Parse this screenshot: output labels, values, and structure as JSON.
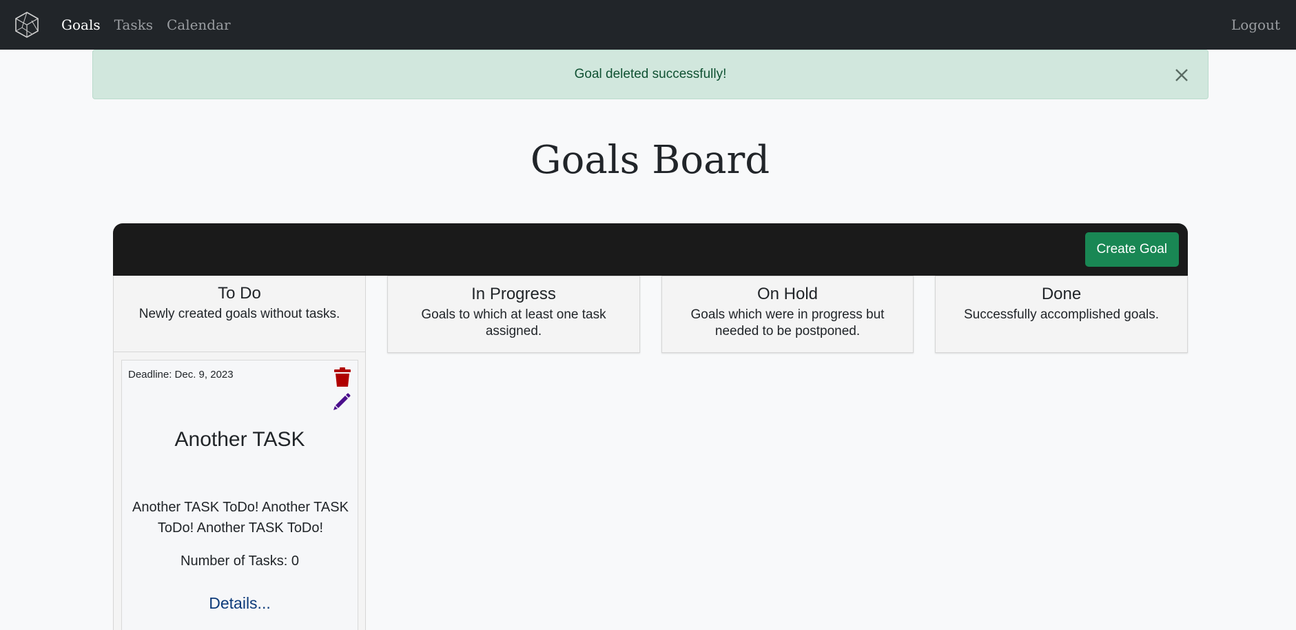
{
  "nav": {
    "brand_icon": "cube-logo-icon",
    "links": [
      {
        "label": "Goals",
        "active": true
      },
      {
        "label": "Tasks",
        "active": false
      },
      {
        "label": "Calendar",
        "active": false
      }
    ],
    "logout_label": "Logout"
  },
  "alert": {
    "message": "Goal deleted successfully!",
    "close_icon": "close-icon",
    "color": "#d1e7dd"
  },
  "page": {
    "title": "Goals Board"
  },
  "board": {
    "create_label": "Create Goal",
    "create_color": "#198754",
    "columns": [
      {
        "title": "To Do",
        "description": "Newly created goals without tasks."
      },
      {
        "title": "In Progress",
        "description": "Goals to which at least one task assigned."
      },
      {
        "title": "On Hold",
        "description": "Goals which were in progress but needed to be postponed."
      },
      {
        "title": "Done",
        "description": "Successfully accomplished goals."
      }
    ]
  },
  "goal_card": {
    "deadline": "Deadline: Dec. 9, 2023",
    "title": "Another TASK",
    "description": "Another TASK ToDo! Another TASK ToDo! Another TASK ToDo!",
    "tasks_count": "Number of Tasks: 0",
    "details_label": "Details...",
    "delete_icon": "trash-icon",
    "edit_icon": "pencil-icon",
    "delete_color": "#b00000",
    "edit_color": "#4b0f8c"
  }
}
